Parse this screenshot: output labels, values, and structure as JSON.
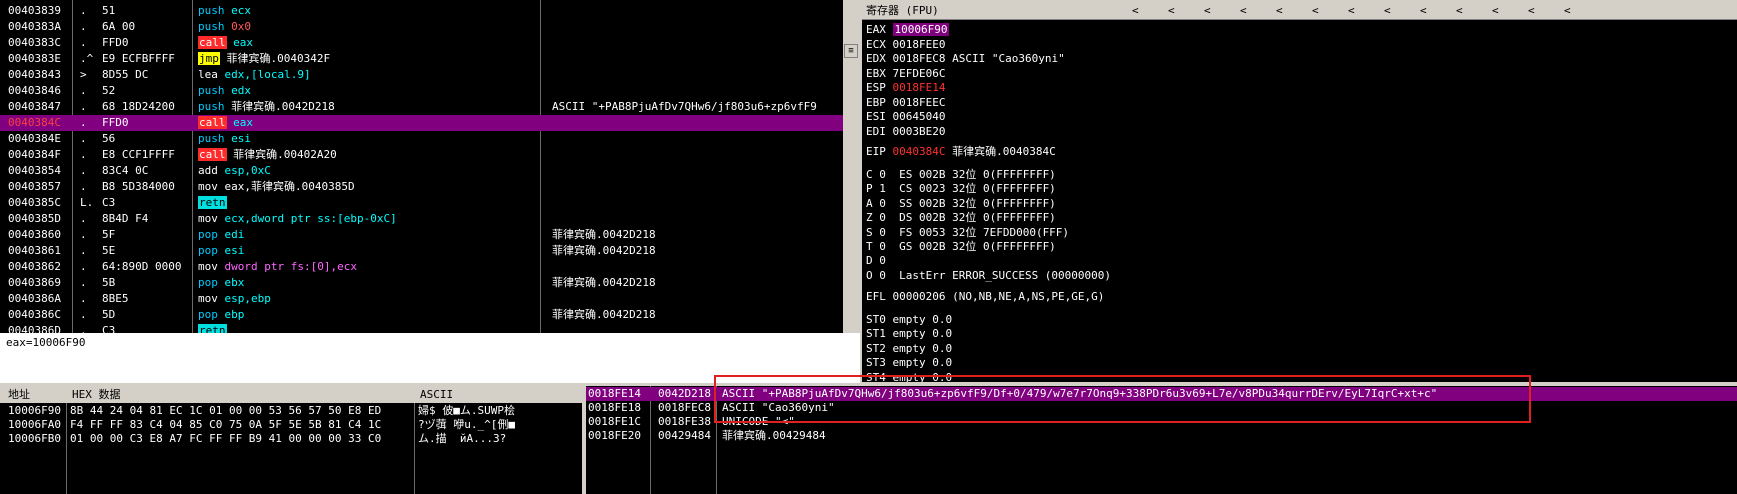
{
  "disasm": {
    "rows": [
      {
        "addr": "00403839",
        "mark": ".",
        "bytes": "51",
        "ins": "push",
        "arg": "ecx",
        "argc": "reg",
        "comment": ""
      },
      {
        "addr": "0040383A",
        "mark": ".",
        "bytes": "6A 00",
        "ins": "push",
        "arg": "0x0",
        "argc": "num",
        "comment": ""
      },
      {
        "addr": "0040383C",
        "mark": ".",
        "bytes": "FFD0",
        "ins": "call",
        "arg": "eax",
        "argc": "reg",
        "comment": ""
      },
      {
        "addr": "0040383E",
        "mark": ".^",
        "bytes": "E9 ECFBFFFF",
        "ins": "jmp",
        "arg": "菲律宾确.0040342F",
        "argc": "",
        "comment": ""
      },
      {
        "addr": "00403843",
        "mark": ">",
        "bytes": "8D55 DC",
        "ins": "lea",
        "arg": "edx,[local.9]",
        "argc": "reg",
        "comment": ""
      },
      {
        "addr": "00403846",
        "mark": ".",
        "bytes": "52",
        "ins": "push",
        "arg": "edx",
        "argc": "reg",
        "comment": ""
      },
      {
        "addr": "00403847",
        "mark": ".",
        "bytes": "68 18D24200",
        "ins": "push",
        "arg": "菲律宾确.0042D218",
        "argc": "",
        "comment": "ASCII \"+PAB8PjuAfDv7QHw6/jf803u6+zp6vfF9"
      },
      {
        "addr": "0040384C",
        "mark": ".",
        "bytes": "FFD0",
        "ins": "call",
        "arg": "eax",
        "argc": "reg",
        "comment": "",
        "selected": true
      },
      {
        "addr": "0040384E",
        "mark": ".",
        "bytes": "56",
        "ins": "push",
        "arg": "esi",
        "argc": "reg",
        "comment": ""
      },
      {
        "addr": "0040384F",
        "mark": ".",
        "bytes": "E8 CCF1FFFF",
        "ins": "call",
        "arg": "菲律宾确.00402A20",
        "argc": "",
        "comment": ""
      },
      {
        "addr": "00403854",
        "mark": ".",
        "bytes": "83C4 0C",
        "ins": "add",
        "arg": "esp,0xC",
        "argc": "mix",
        "comment": ""
      },
      {
        "addr": "00403857",
        "mark": ".",
        "bytes": "B8 5D384000",
        "ins": "mov",
        "arg": "eax,菲律宾确.0040385D",
        "argc": "",
        "comment": ""
      },
      {
        "addr": "0040385C",
        "mark": "L.",
        "bytes": "C3",
        "ins": "retn",
        "arg": "",
        "argc": "",
        "comment": ""
      },
      {
        "addr": "0040385D",
        "mark": ".",
        "bytes": "8B4D F4",
        "ins": "mov",
        "arg": "ecx,dword ptr ss:[ebp-0xC]",
        "argc": "reg",
        "comment": ""
      },
      {
        "addr": "00403860",
        "mark": ".",
        "bytes": "5F",
        "ins": "pop",
        "arg": "edi",
        "argc": "reg",
        "comment": "菲律宾确.0042D218"
      },
      {
        "addr": "00403861",
        "mark": ".",
        "bytes": "5E",
        "ins": "pop",
        "arg": "esi",
        "argc": "reg",
        "comment": "菲律宾确.0042D218"
      },
      {
        "addr": "00403862",
        "mark": ".",
        "bytes": "64:890D 0000",
        "ins": "mov",
        "arg": "dword ptr fs:[0],ecx",
        "argc": "ptr",
        "comment": ""
      },
      {
        "addr": "00403869",
        "mark": ".",
        "bytes": "5B",
        "ins": "pop",
        "arg": "ebx",
        "argc": "reg",
        "comment": "菲律宾确.0042D218"
      },
      {
        "addr": "0040386A",
        "mark": ".",
        "bytes": "8BE5",
        "ins": "mov",
        "arg": "esp,ebp",
        "argc": "reg",
        "comment": ""
      },
      {
        "addr": "0040386C",
        "mark": ".",
        "bytes": "5D",
        "ins": "pop",
        "arg": "ebp",
        "argc": "reg",
        "comment": "菲律宾确.0042D218"
      },
      {
        "addr": "0040386D",
        "mark": ".",
        "bytes": "C3",
        "ins": "retn",
        "arg": "",
        "argc": "",
        "comment": ""
      },
      {
        "addr": "0040386E",
        "mark": ".",
        "bytes": "90",
        "ins": "nop",
        "arg": "",
        "argc": "",
        "comment": ""
      },
      {
        "addr": "0040386F",
        "mark": ".",
        "bytes": "90",
        "ins": "nop",
        "arg": "",
        "argc": "",
        "comment": ""
      }
    ]
  },
  "info": {
    "text": "eax=10006F90"
  },
  "registers": {
    "title": "寄存器 (FPU)",
    "arrows": [
      "<",
      "<",
      "<",
      "<",
      "<",
      "<",
      "<",
      "<",
      "<",
      "<",
      "<",
      "<",
      "<"
    ],
    "regs": [
      {
        "name": "EAX",
        "value": "10006F90",
        "desc": "",
        "style": "hilite"
      },
      {
        "name": "ECX",
        "value": "0018FEE0",
        "desc": "",
        "style": ""
      },
      {
        "name": "EDX",
        "value": "0018FEC8",
        "desc": "ASCII \"Cao360yni\"",
        "style": ""
      },
      {
        "name": "EBX",
        "value": "7EFDE06C",
        "desc": "",
        "style": ""
      },
      {
        "name": "ESP",
        "value": "0018FE14",
        "desc": "",
        "style": "red"
      },
      {
        "name": "EBP",
        "value": "0018FEEC",
        "desc": "",
        "style": ""
      },
      {
        "name": "ESI",
        "value": "00645040",
        "desc": "",
        "style": ""
      },
      {
        "name": "EDI",
        "value": "0003BE20",
        "desc": "",
        "style": ""
      }
    ],
    "eip": {
      "name": "EIP",
      "value": "0040384C",
      "desc": "菲律宾确.0040384C"
    },
    "flags": [
      "C 0  ES 002B 32位 0(FFFFFFFF)",
      "P 1  CS 0023 32位 0(FFFFFFFF)",
      "A 0  SS 002B 32位 0(FFFFFFFF)",
      "Z 0  DS 002B 32位 0(FFFFFFFF)",
      "S 0  FS 0053 32位 7EFDD000(FFF)",
      "T 0  GS 002B 32位 0(FFFFFFFF)",
      "D 0",
      "O 0  LastErr ERROR_SUCCESS (00000000)"
    ],
    "efl": "EFL 00000206 (NO,NB,NE,A,NS,PE,GE,G)",
    "fpu": [
      "ST0 empty 0.0",
      "ST1 empty 0.0",
      "ST2 empty 0.0",
      "ST3 empty 0.0",
      "ST4 empty 0.0"
    ]
  },
  "dump": {
    "headers": {
      "addr": "地址",
      "hex": "HEX 数据",
      "ascii": "ASCII"
    },
    "rows": [
      {
        "addr": "10006F90",
        "hex": "8B 44 24 04 81 EC 1C 01 00 00 53 56 57 50 E8 ED",
        "ascii": "婦$ 佊■ム.SUWP桧"
      },
      {
        "addr": "10006FA0",
        "hex": "F4 FF FF 83 C4 04 85 C0 75 0A 5F 5E 5B 81 C4 1C",
        "ascii": "?ヅ葞 咿u._^[侀■"
      },
      {
        "addr": "10006FB0",
        "hex": "01 00 00 C3 E8 A7 FC FF FF B9 41 00 00 00 33 C0",
        "ascii": "ム.描  йA...3?"
      }
    ]
  },
  "stack": {
    "rows": [
      {
        "addr": "0018FE14",
        "val": "0042D218",
        "desc": "ASCII \"+PAB8PjuAfDv7QHw6/jf803u6+zp6vfF9/Df+0/479/w7e7r7Onq9+338PDr6u3v69+L7e/v8PDu34qurrDErv/EyL7IqrC+xt+c\"",
        "selected": true
      },
      {
        "addr": "0018FE18",
        "val": "0018FEC8",
        "desc": "ASCII \"Cao360yni\""
      },
      {
        "addr": "0018FE1C",
        "val": "0018FE38",
        "desc": "UNICODE \"<\""
      },
      {
        "addr": "0018FE20",
        "val": "00429484",
        "desc": "菲律宾确.00429484"
      }
    ]
  }
}
